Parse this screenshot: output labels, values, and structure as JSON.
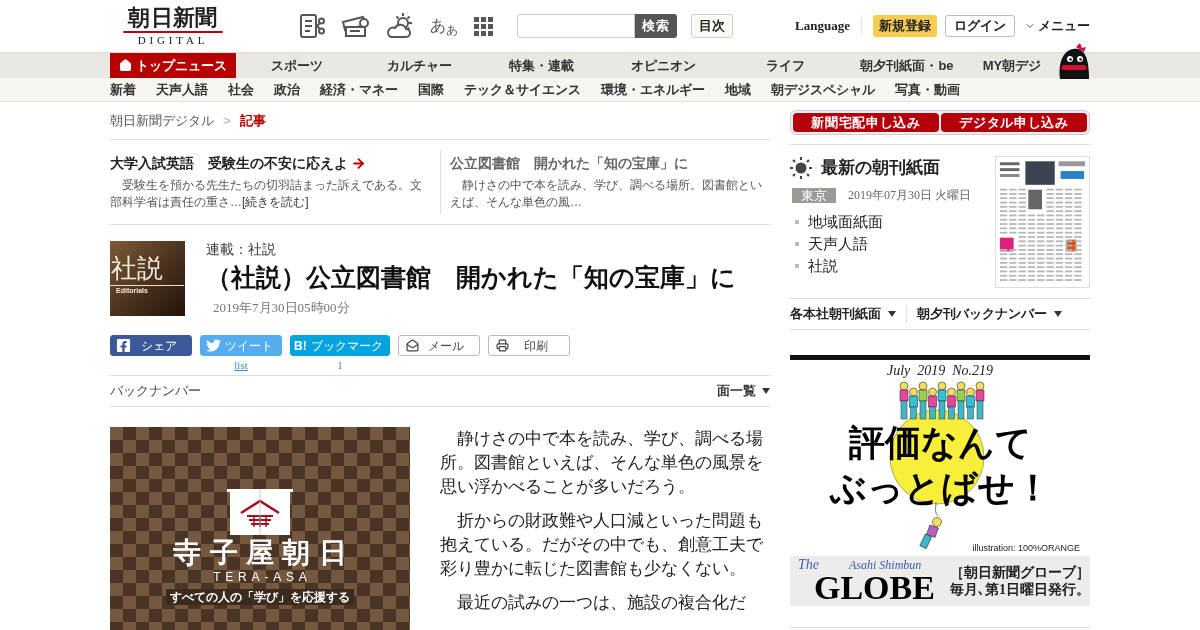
{
  "header": {
    "logo": {
      "title": "朝日新聞",
      "subtitle": "DIGITAL"
    },
    "text_size_label": "あ$_{あ}$",
    "search_button": "検索",
    "index_button": "目次",
    "language": "Language",
    "register": "新規登録",
    "login": "ログイン",
    "menu": "メニュー"
  },
  "nav_primary": [
    {
      "label": "トップニュース",
      "selected": true
    },
    {
      "label": "スポーツ",
      "selected": false
    },
    {
      "label": "カルチャー",
      "selected": false
    },
    {
      "label": "特集・連載",
      "selected": false
    },
    {
      "label": "オピニオン",
      "selected": false
    },
    {
      "label": "ライフ",
      "selected": false
    },
    {
      "label": "朝夕刊紙面・be",
      "selected": false
    },
    {
      "label": "MY朝デジ",
      "selected": false
    }
  ],
  "nav_secondary": [
    "新着",
    "天声人語",
    "社会",
    "政治",
    "経済・マネー",
    "国際",
    "テック＆サイエンス",
    "環境・エネルギー",
    "地域",
    "朝デジスペシャル",
    "写真・動画"
  ],
  "breadcrumb": {
    "separator": ">",
    "items": [
      {
        "label": "朝日新聞デジタル",
        "current": false
      },
      {
        "label": "記事",
        "current": true
      }
    ]
  },
  "related": [
    {
      "title": "大学入試英語　受験生の不安に応えよ",
      "current": false,
      "excerpt": "　受験生を預かる先生たちの切羽詰まった訴えである。文部科学省は責任の重さ…",
      "more": "[続きを読む]"
    },
    {
      "title": "公立図書館　開かれた「知の宝庫」に",
      "current": true,
      "excerpt": "　静けさの中で本を読み、学び、調べる場所。図書館といえば、そんな単色の風…"
    }
  ],
  "article": {
    "thumbnail": {
      "title": "社説",
      "subtitle": "Editorials"
    },
    "series": "連載：社説",
    "title": "（社説）公立図書館　開かれた「知の宝庫」に",
    "date": "2019年7月30日05時00分",
    "share": [
      {
        "kind": "facebook",
        "label": "シェア"
      },
      {
        "kind": "twitter",
        "label": "ツイート",
        "count": "list"
      },
      {
        "kind": "hatena",
        "logo": "B!",
        "label": "ブックマーク",
        "count": "1"
      },
      {
        "kind": "mail",
        "label": "メール"
      },
      {
        "kind": "print",
        "label": "印刷"
      }
    ],
    "back_number": "バックナンバー",
    "page_list": "面一覧",
    "paragraphs": [
      "　静けさの中で本を読み、学び、調べる場所。図書館といえば、そんな単色の風景を思い浮かべることが多いだろう。",
      "　折からの財政難や人口減といった問題も抱えている。だがその中でも、創意工夫で彩り豊かに転じた図書館も少なくない。",
      "　最近の試みの一つは、施設の複合化だ"
    ]
  },
  "banner": {
    "title": "寺子屋朝日",
    "subtitle": "TERA-ASA",
    "tagline": "すべての人の「学び」を応援する"
  },
  "sidebar": {
    "subscribe": [
      "新聞宅配申し込み",
      "デジタル申し込み"
    ],
    "paper": {
      "heading": "最新の朝刊紙面",
      "region": "東京",
      "date": "2019年07月30日 火曜日",
      "links": [
        "地域面紙面",
        "天声人語",
        "社説"
      ]
    },
    "dropdowns": [
      "各本社朝刊紙面",
      "朝夕刊バックナンバー"
    ],
    "ad": {
      "issue": "July  2019  No.219",
      "headline": [
        "評価なんて",
        "ぶっとばせ！"
      ],
      "credit": "illustration: 100%ORANGE",
      "brand_prefix": "The",
      "brand_script": "Asahi Shimbun",
      "brand": "GLOBE",
      "tagline": [
        "［朝日新聞グローブ］",
        "毎月､第1日曜日発行。"
      ]
    }
  }
}
